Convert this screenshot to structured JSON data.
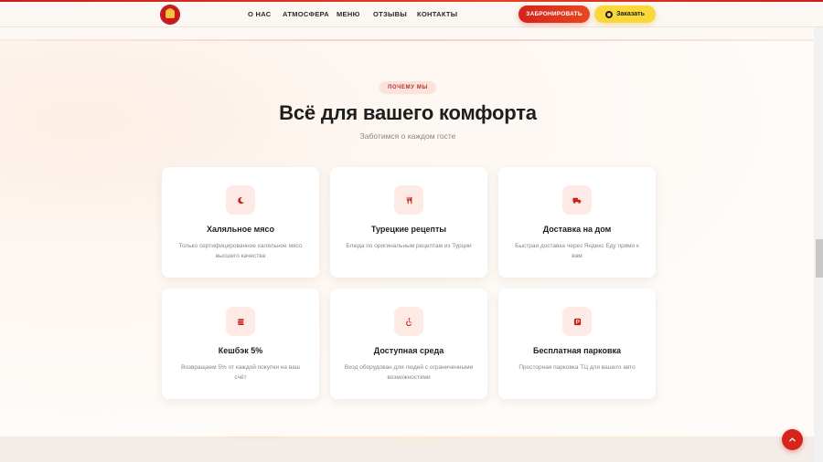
{
  "header": {
    "nav": [
      "О НАС",
      "АТМОСФЕРА",
      "МЕНЮ",
      "ОТЗЫВЫ",
      "КОНТАКТЫ"
    ],
    "book_label": "ЗАБРОНИРОВАТЬ",
    "order_label": "Заказать"
  },
  "section": {
    "badge": "ПОЧЕМУ МЫ",
    "title": "Всё для вашего комфорта",
    "subtitle": "Заботимся о каждом госте",
    "features": [
      {
        "title": "Халяльное мясо",
        "text": "Только сертифицированное халяльное мясо высшего качества",
        "icon": "crescent-moon-icon"
      },
      {
        "title": "Турецкие рецепты",
        "text": "Блюда по оригинальным рецептам из Турции",
        "icon": "utensils-icon"
      },
      {
        "title": "Доставка на дом",
        "text": "Быстрая доставка через Яндекс Еду прямо к вам",
        "icon": "delivery-truck-icon"
      },
      {
        "title": "Кешбэк 5%",
        "text": "Возвращаем 5% от каждой покупки на ваш счёт",
        "icon": "coins-icon"
      },
      {
        "title": "Доступная среда",
        "text": "Вход оборудован для людей с ограниченными возможностями",
        "icon": "wheelchair-icon"
      },
      {
        "title": "Бесплатная парковка",
        "text": "Просторная парковка ТЦ для вашего авто",
        "icon": "parking-icon"
      }
    ]
  },
  "colors": {
    "accent": "#d5241c",
    "yellow": "#fbd83a",
    "icon_bg": "#fdeae4"
  }
}
